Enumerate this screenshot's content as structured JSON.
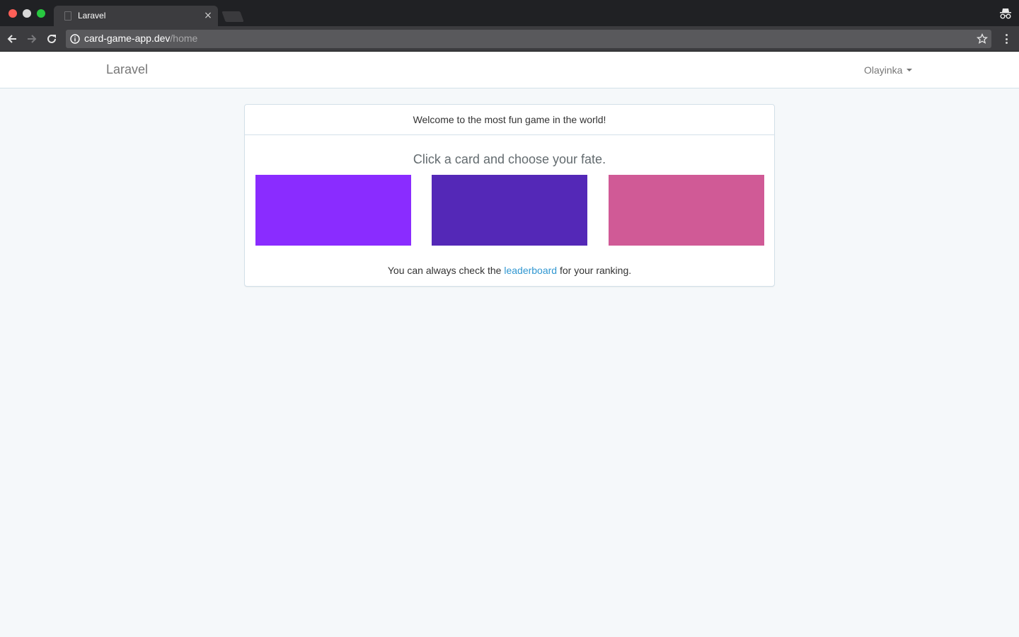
{
  "browser": {
    "tab_title": "Laravel",
    "tab_close": "×",
    "url_host": "card-game-app.dev",
    "url_path": "/home"
  },
  "navbar": {
    "brand": "Laravel",
    "user_name": "Olayinka"
  },
  "panel": {
    "heading": "Welcome to the most fun game in the world!",
    "subtitle": "Click a card and choose your fate.",
    "cards": [
      {
        "color": "#8a2cff"
      },
      {
        "color": "#5428b7"
      },
      {
        "color": "#d05a96"
      }
    ],
    "footer_before": "You can always check the ",
    "footer_link": "leaderboard",
    "footer_after": " for your ranking."
  },
  "colors": {
    "page_bg": "#f5f8fa",
    "link": "#3097d1",
    "browser_dark": "#202124"
  }
}
